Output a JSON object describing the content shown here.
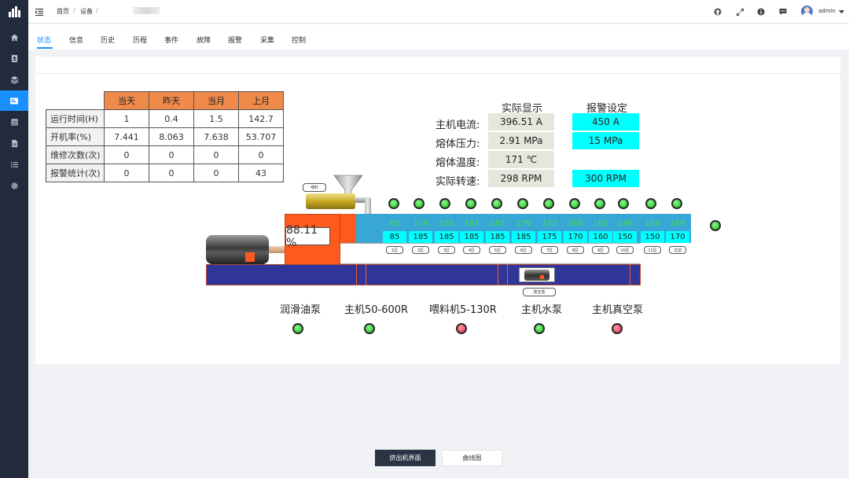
{
  "topbar": {
    "breadcrumb": [
      "首页",
      "设备"
    ],
    "separator": "/",
    "user": "admin"
  },
  "tabs": [
    "状态",
    "信息",
    "历史",
    "历程",
    "事件",
    "故障",
    "报警",
    "采集",
    "控制"
  ],
  "stats_table": {
    "columns": [
      "当天",
      "昨天",
      "当月",
      "上月"
    ],
    "rows": [
      {
        "label": "运行时间(H)",
        "values": [
          "1",
          "0.4",
          "1.5",
          "142.7"
        ]
      },
      {
        "label": "开机率(%)",
        "values": [
          "7.441",
          "8.063",
          "7.638",
          "53.707"
        ]
      },
      {
        "label": "维修次数(次)",
        "values": [
          "0",
          "0",
          "0",
          "0"
        ]
      },
      {
        "label": "报警统计(次)",
        "values": [
          "0",
          "0",
          "0",
          "43"
        ]
      }
    ]
  },
  "readings": {
    "header_actual": "实际显示",
    "header_alarm": "报警设定",
    "rows": [
      {
        "label": "主机电流:",
        "actual": "396.51 A",
        "alarm": "450 A"
      },
      {
        "label": "熔体压力:",
        "actual": "2.91 MPa",
        "alarm": "15 MPa"
      },
      {
        "label": "熔体温度:",
        "actual": "171 ℃",
        "alarm": ""
      },
      {
        "label": "实际转速:",
        "actual": "298 RPM",
        "alarm": "300 RPM"
      }
    ]
  },
  "machine": {
    "percent": "88.11 %",
    "feeder_label": "喂料",
    "vacuum_label": "真空泵",
    "zones": [
      {
        "actual": "85",
        "set": "85",
        "label": "1区"
      },
      {
        "actual": "174",
        "set": "185",
        "label": "2区"
      },
      {
        "actual": "185",
        "set": "185",
        "label": "3区"
      },
      {
        "actual": "187",
        "set": "185",
        "label": "4区"
      },
      {
        "actual": "187",
        "set": "185",
        "label": "5区"
      },
      {
        "actual": "179",
        "set": "185",
        "label": "6区"
      },
      {
        "actual": "172",
        "set": "175",
        "label": "7区"
      },
      {
        "actual": "168",
        "set": "170",
        "label": "8区"
      },
      {
        "actual": "162",
        "set": "160",
        "label": "9区"
      },
      {
        "actual": "148",
        "set": "150",
        "label": "10区"
      },
      {
        "actual": "150",
        "set": "150",
        "label": "11区"
      },
      {
        "actual": "169",
        "set": "170",
        "label": "过滤"
      }
    ],
    "zone_lights": [
      "green",
      "green",
      "green",
      "green",
      "green",
      "green",
      "green",
      "green",
      "green",
      "green",
      "green",
      "green",
      "green"
    ],
    "extra_light": "green"
  },
  "equipment": [
    {
      "label": "润滑油泵",
      "status": "green"
    },
    {
      "label": "主机50-600R",
      "status": "green"
    },
    {
      "label": "喂料机5-130R",
      "status": "red"
    },
    {
      "label": "主机水泵",
      "status": "green"
    },
    {
      "label": "主机真空泵",
      "status": "red"
    }
  ],
  "bottom_buttons": [
    "挤出机界面",
    "曲线图"
  ],
  "colors": {
    "sidebar": "#222b3c",
    "accent": "#1890ff",
    "table_header": "#f08a4b",
    "cyan": "#00ffff",
    "motor_orange": "#ff5a1e",
    "barrel_blue": "#2f3599",
    "zone_bar": "#38a7d6"
  }
}
